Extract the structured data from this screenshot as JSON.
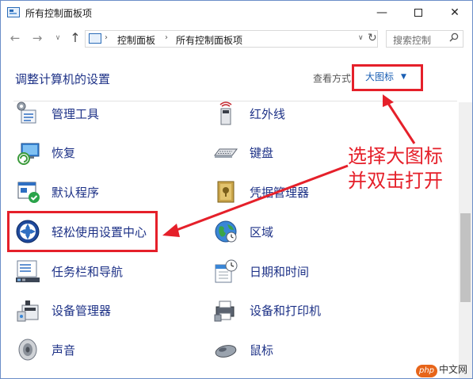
{
  "window": {
    "title": "所有控制面板项",
    "minimize_glyph": "—",
    "close_glyph": "✕"
  },
  "navigation": {
    "back_glyph": "←",
    "forward_glyph": "→",
    "recent_glyph": "∨",
    "up_glyph": "↑",
    "breadcrumb": [
      "控制面板",
      "所有控制面板项"
    ],
    "separator": "›",
    "dropdown_glyph": "∨",
    "refresh_glyph": "↻",
    "search_placeholder": "搜索控制"
  },
  "header": {
    "title": "调整计算机的设置",
    "view_by_label": "查看方式:",
    "view_by_value": "大图标",
    "view_by_caret": "▼"
  },
  "items": {
    "admin_tools": {
      "label": "管理工具",
      "icon": "admin-tools-icon"
    },
    "infrared": {
      "label": "红外线",
      "icon": "infrared-icon"
    },
    "recovery": {
      "label": "恢复",
      "icon": "recovery-icon"
    },
    "keyboard": {
      "label": "键盘",
      "icon": "keyboard-icon"
    },
    "default_programs": {
      "label": "默认程序",
      "icon": "default-programs-icon"
    },
    "credential_manager": {
      "label": "凭据管理器",
      "icon": "credential-manager-icon"
    },
    "ease_of_access": {
      "label": "轻松使用设置中心",
      "icon": "ease-of-access-icon"
    },
    "region": {
      "label": "区域",
      "icon": "globe-icon"
    },
    "taskbar": {
      "label": "任务栏和导航",
      "icon": "taskbar-icon"
    },
    "date_time": {
      "label": "日期和时间",
      "icon": "calendar-clock-icon"
    },
    "device_manager": {
      "label": "设备管理器",
      "icon": "device-manager-icon"
    },
    "devices_printers": {
      "label": "设备和打印机",
      "icon": "printer-icon"
    },
    "sound": {
      "label": "声音",
      "icon": "speaker-icon"
    },
    "mouse": {
      "label": "鼠标",
      "icon": "mouse-icon"
    }
  },
  "annotation": {
    "line1": "选择大图标",
    "line2": "并双击打开",
    "color": "#e5202a"
  },
  "watermark": {
    "badge": "php",
    "text": "中文网"
  },
  "colors": {
    "link_blue": "#1e3287",
    "accent_blue": "#1a5fb4",
    "highlight_red": "#e5202a"
  }
}
